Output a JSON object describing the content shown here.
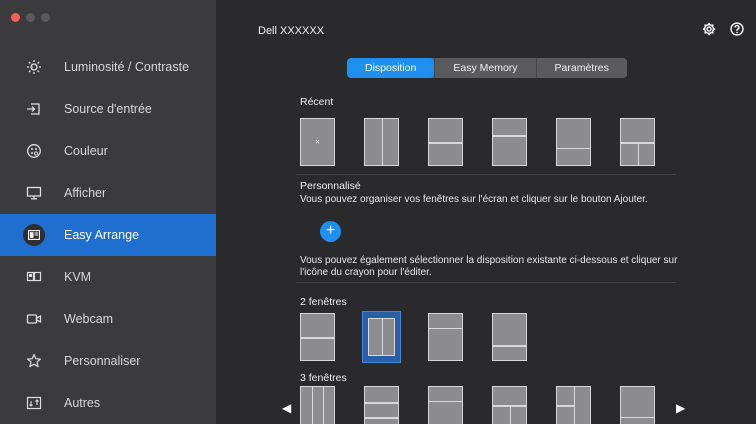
{
  "window": {
    "title": "Dell XXXXXX"
  },
  "sidebar": {
    "items": [
      {
        "label": "Luminosité / Contraste",
        "icon": "brightness-icon"
      },
      {
        "label": "Source d'entrée",
        "icon": "input-source-icon"
      },
      {
        "label": "Couleur",
        "icon": "color-icon"
      },
      {
        "label": "Afficher",
        "icon": "display-icon"
      },
      {
        "label": "Easy Arrange",
        "icon": "easy-arrange-icon"
      },
      {
        "label": "KVM",
        "icon": "kvm-icon"
      },
      {
        "label": "Webcam",
        "icon": "webcam-icon"
      },
      {
        "label": "Personnaliser",
        "icon": "star-icon"
      },
      {
        "label": "Autres",
        "icon": "others-icon"
      }
    ],
    "active_index": 4
  },
  "tabs": [
    {
      "label": "Disposition",
      "active": true
    },
    {
      "label": "Easy Memory",
      "active": false
    },
    {
      "label": "Paramètres",
      "active": false
    }
  ],
  "recent": {
    "label": "Récent",
    "close_glyph": "×"
  },
  "custom": {
    "label": "Personnalisé",
    "description": "Vous pouvez organiser vos fenêtres sur l'écran et cliquer sur le bouton Ajouter.",
    "add_glyph": "+"
  },
  "existing": {
    "description": "Vous pouvez également sélectionner la disposition existante ci-dessous et cliquer sur l'icône du crayon pour l'éditer."
  },
  "groups": [
    {
      "label": "2 fenêtres",
      "selected_index": 1
    },
    {
      "label": "3 fenêtres"
    }
  ],
  "nav_arrows": {
    "left": "◀",
    "right": "▶"
  },
  "colors": {
    "accent": "#1f6fd1",
    "tab_active": "#1f8ff0",
    "sidebar_bg": "#3b3b3d",
    "main_bg": "#2a2a2c"
  }
}
